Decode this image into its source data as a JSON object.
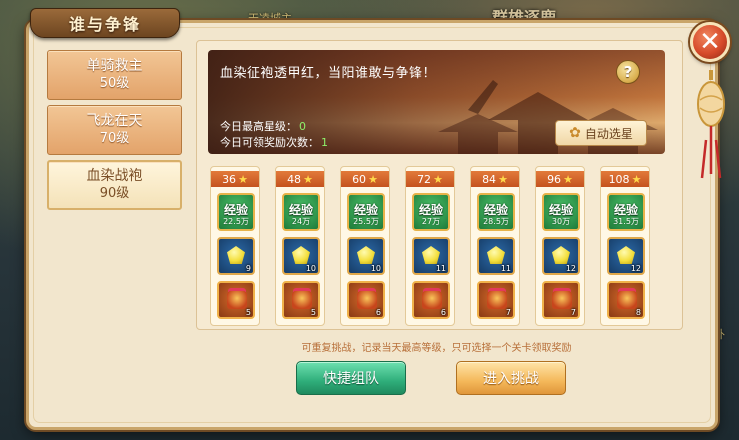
{
  "panel": {
    "title": "谁与争锋"
  },
  "world": {
    "sign": "群雄逐鹿",
    "npc_label": "天凌城主",
    "edge_label": "例外"
  },
  "levels": [
    {
      "name": "单骑救主",
      "level": "50级",
      "active": false
    },
    {
      "name": "飞龙在天",
      "level": "70级",
      "active": false
    },
    {
      "name": "血染战袍",
      "level": "90级",
      "active": true
    }
  ],
  "banner": {
    "tagline": "血染征袍透甲红，当阳谁敢与争锋！",
    "best_star_label": "今日最高星级：",
    "best_star_value": "0",
    "rewards_label": "今日可领奖励次数：",
    "rewards_value": "1",
    "auto_select": "自动选星"
  },
  "stages": [
    {
      "stars": "36",
      "exp_label": "经验",
      "exp_amount": "22.5万",
      "gem_count": "9",
      "box_count": "5"
    },
    {
      "stars": "48",
      "exp_label": "经验",
      "exp_amount": "24万",
      "gem_count": "10",
      "box_count": "5"
    },
    {
      "stars": "60",
      "exp_label": "经验",
      "exp_amount": "25.5万",
      "gem_count": "10",
      "box_count": "6"
    },
    {
      "stars": "72",
      "exp_label": "经验",
      "exp_amount": "27万",
      "gem_count": "11",
      "box_count": "6"
    },
    {
      "stars": "84",
      "exp_label": "经验",
      "exp_amount": "28.5万",
      "gem_count": "11",
      "box_count": "7"
    },
    {
      "stars": "96",
      "exp_label": "经验",
      "exp_amount": "30万",
      "gem_count": "12",
      "box_count": "7"
    },
    {
      "stars": "108",
      "exp_label": "经验",
      "exp_amount": "31.5万",
      "gem_count": "12",
      "box_count": "8"
    }
  ],
  "hint": "可重复挑战，记录当天最高等级，只可选择一个关卡领取奖励",
  "buttons": {
    "team": "快捷组队",
    "enter": "进入挑战"
  },
  "colors": {
    "accent_orange": "#c4521e",
    "team_green": "#2fae7a",
    "enter_gold": "#f4b85a",
    "close_red": "#d64a2a"
  }
}
